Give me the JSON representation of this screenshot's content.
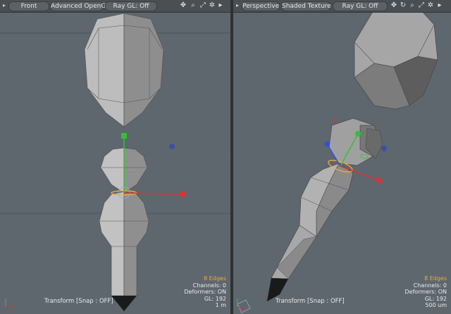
{
  "viewports": [
    {
      "id": "left",
      "menu_icon": "menu-arrow-icon",
      "view_label": "Front",
      "shading_label": "Advanced OpenGL",
      "raygl_label": "Ray GL: Off",
      "icons": [
        "move-icon",
        "zoom-icon",
        "maximize-icon",
        "settings-icon",
        "expand-arrow-icon"
      ],
      "hud": {
        "selection": "8 Edges",
        "channels": "Channels: 0",
        "deformers": "Deformers: ON",
        "gl": "GL: 192",
        "scale": "1 m"
      },
      "status": "Transform  [Snap : OFF]"
    },
    {
      "id": "right",
      "menu_icon": "menu-arrow-icon",
      "view_label": "Perspective",
      "shading_label": "Shaded Texture",
      "raygl_label": "Ray GL: Off",
      "icons": [
        "move-icon",
        "rotate-icon",
        "zoom-icon",
        "maximize-icon",
        "settings-icon",
        "expand-arrow-icon"
      ],
      "hud": {
        "selection": "8 Edges",
        "channels": "Channels: 0",
        "deformers": "Deformers: ON",
        "gl": "GL: 192",
        "scale": "500 um"
      },
      "status": "Transform  [Snap : OFF]"
    }
  ],
  "colors": {
    "viewport_bg": "#5e676e",
    "mesh_light": "#c8c8c8",
    "mesh_dark": "#8c8c8c",
    "x_axis": "#e03030",
    "y_axis": "#34c034",
    "z_axis": "#3050e0",
    "selection": "#f0a83c"
  }
}
